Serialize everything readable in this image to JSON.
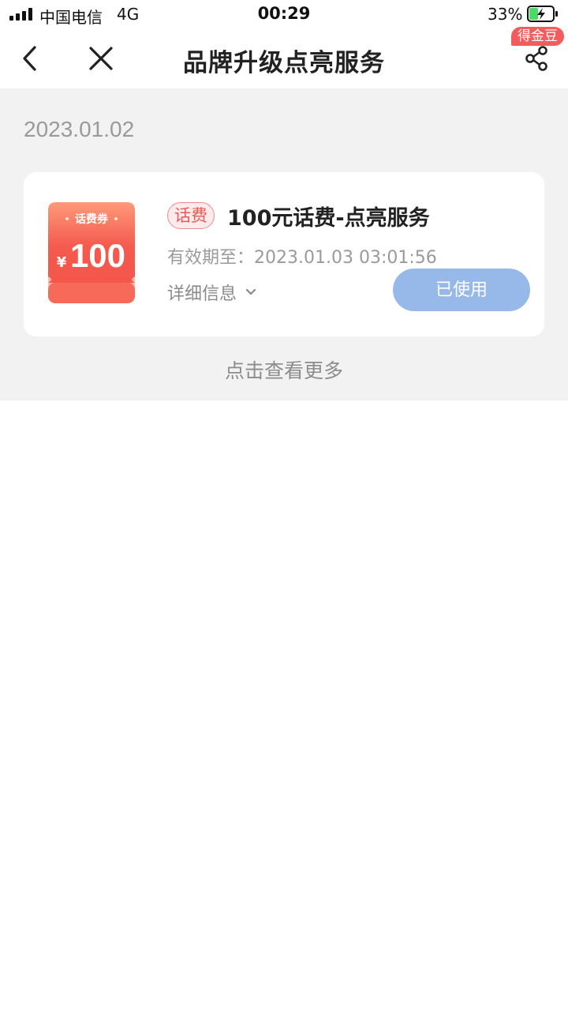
{
  "status_bar": {
    "carrier": "中国电信",
    "network": "4G",
    "time": "00:29",
    "battery_percent": "33%"
  },
  "nav": {
    "title": "品牌升级点亮服务",
    "badge": "得金豆",
    "icons": [
      "chevron-left-icon",
      "close-icon",
      "share-icon"
    ]
  },
  "list": {
    "date": "2023.01.02",
    "coupon": {
      "ticket_label": "话费券",
      "ticket_currency": "¥",
      "ticket_amount": "100",
      "tag": "话费",
      "title": "100元话费-点亮服务",
      "validity_label": "有效期至：",
      "validity_value": "2023.01.03 03:01:56",
      "detail_label": "详细信息",
      "status_button": "已使用"
    },
    "more_link": "点击查看更多"
  },
  "colors": {
    "accent_red": "#f35c5c",
    "used_button": "#97b9ea",
    "section_bg": "#f2f2f2"
  }
}
